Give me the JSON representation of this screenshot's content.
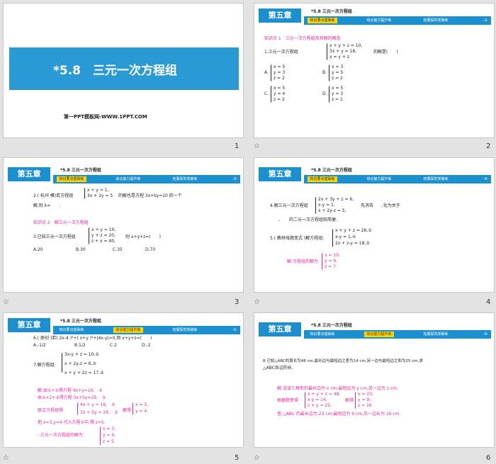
{
  "slides": {
    "s1": {
      "title": "*5.8　三元一次方程组",
      "subtitle": "第一PPT模板网-WWW.1PPT.COM",
      "num": "1"
    },
    "header": {
      "chapter": "第五章",
      "title": "*5.8  三元一次方程组",
      "tab1": "知识要点基础练",
      "tab2": "综合能力提升练",
      "tab3": "拓展探究突破练"
    },
    "s2": {
      "num": "2",
      "pg": "-2-",
      "kp": "知识点 1　三元一次方程组及其解的概念",
      "q1": "1.三元一次方程组",
      "q1sys": [
        "x + y + z = 10,",
        "3x + y = 18,",
        "x = y + z"
      ],
      "q1tail": "的解是(　　)",
      "A": [
        "x = 5",
        "y = 3",
        "z = 2"
      ],
      "B": [
        "x = 3",
        "y = 5",
        "z = 2"
      ],
      "C": [
        "x = 5",
        "y = 4",
        "z = 2"
      ],
      "D": [
        "x = 5",
        "y = 3",
        "z = 1"
      ]
    },
    "s3": {
      "num": "3",
      "pg": "-3-",
      "q2a": "2.( 杭州 模)若方程组",
      "q2sys": [
        "x + y = 1,",
        "3x + 2y = 5"
      ],
      "q2b": "的解也是方程 3x+ky=10 的一个",
      "q2c": "解,则 k=　　.",
      "kp": "知识点 2　解三元一次方程组",
      "q3a": "3.已知三元一次方程组",
      "q3sys": [
        "x + y = 10,",
        "y + z = 20,",
        "z + x = 40,"
      ],
      "q3b": "则 x+y+z=(　　)",
      "opts": [
        "A.20",
        "B.30",
        "C.35",
        "D.70"
      ]
    },
    "s4": {
      "num": "4",
      "pg": "-4-",
      "q4a": "4.解三元一次方程组",
      "q4sys": [
        "2x + 3y + z = 6,",
        "x-y = 1,",
        "x + 2y-z = 5,"
      ],
      "q4b": "先消去　　,化为关于",
      "q4c": "　　、　　的二元一次方程组较简便.",
      "q5a": "5.( 教材母题变式 )解方程组:",
      "q5sys": [
        "x + y + z = 26,①",
        "x-y = 1,②",
        "2x + z-y = 18.③"
      ],
      "ans": "解:方程组的解为",
      "anssys": [
        "x = 10,",
        "y = 9,",
        "z = 7."
      ]
    },
    "s5": {
      "num": "5",
      "pg": "-5-",
      "q6": "6.( 原创 )若( 2x-4 )²+( x+y )²+|4x-y|=0,则 x+y+z=(　　)",
      "q6opts": [
        "A.-1/2",
        "B.1/2",
        "C.2",
        "D.-2"
      ],
      "q7": "7.解方程组:",
      "q7sys": [
        "3x-y + z = 10,①",
        "x + 2y-z = 6,②",
        "x + y + 2z = 17.②"
      ],
      "sol": [
        "解:由①+②得方程 4x+y=16,　④",
        "由②×2+③得方程 3x+5y=29,　⑤",
        "联立方程组得",
        "把 x=3,y=4 代入方程①中,得 z=5.",
        "∴三元一次方程组的解为"
      ],
      "sol_sys1": [
        "4x + y = 16,　④",
        "3x + 5y = 29,　⑤"
      ],
      "sol_mid": "解得",
      "sol_sys2": [
        "x = 3,",
        "y = 4."
      ],
      "sol_sys3": [
        "x = 3,",
        "y = 4,",
        "z = 5."
      ]
    },
    "s6": {
      "num": "6",
      "pg": "-6-",
      "q8a": "8.已知△ABC的周长为48 cm,最长边与最短边之差为14 cm,另一边与最短边之和为25 cm,求",
      "q8b": "△ABC各边的长.",
      "sol1": "解:设该三角形的最长边为 x cm,最短边为 y cm,另一边为 z cm,",
      "sol2a": "根据题意得",
      "sol2sys": [
        "x + y + z = 48,",
        "x-y = 14,",
        "z + y = 25,"
      ],
      "sol2b": "解得",
      "sol2sys2": [
        "x = 23,",
        "y = 9,",
        "z = 16"
      ],
      "sol3": "答:△ABC 的最长边为 23 cm,最短边为 9 cm,另一边长为 16 cm."
    }
  },
  "colors": {
    "accent": "#1c8fce",
    "tab_active": "#ffd200",
    "answer": "#e0259b"
  }
}
